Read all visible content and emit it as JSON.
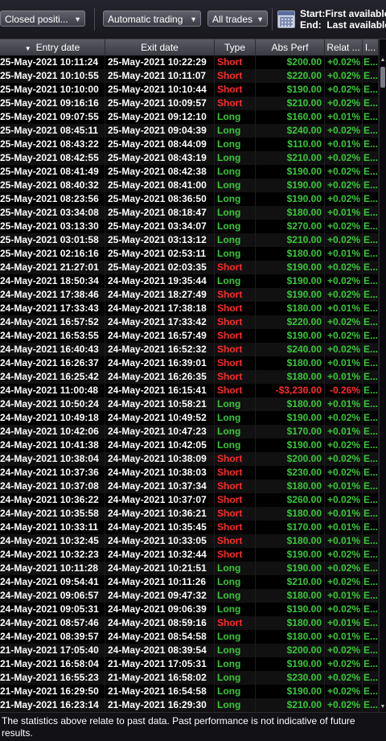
{
  "toolbar": {
    "positions_filter": "Closed positi...",
    "trading_filter": "Automatic trading",
    "trades_filter": "All trades",
    "start_label": "Start:",
    "start_value": "First available",
    "end_label": "End:",
    "end_value": "Last available"
  },
  "columns": {
    "entry": "Entry date",
    "exit": "Exit date",
    "type": "Type",
    "abs": "Abs Perf",
    "rel": "Relat ...",
    "last": "I..."
  },
  "rows": [
    {
      "entry": "25-May-2021 10:11:24",
      "exit": "25-May-2021 10:22:29",
      "type": "Short",
      "abs": "$200.00",
      "rel": "+0.02%",
      "last": "E..."
    },
    {
      "entry": "25-May-2021 10:10:55",
      "exit": "25-May-2021 10:11:07",
      "type": "Short",
      "abs": "$220.00",
      "rel": "+0.02%",
      "last": "E..."
    },
    {
      "entry": "25-May-2021 10:10:00",
      "exit": "25-May-2021 10:10:44",
      "type": "Short",
      "abs": "$190.00",
      "rel": "+0.02%",
      "last": "E..."
    },
    {
      "entry": "25-May-2021 09:16:16",
      "exit": "25-May-2021 10:09:57",
      "type": "Short",
      "abs": "$210.00",
      "rel": "+0.02%",
      "last": "E..."
    },
    {
      "entry": "25-May-2021 09:07:55",
      "exit": "25-May-2021 09:12:10",
      "type": "Long",
      "abs": "$160.00",
      "rel": "+0.01%",
      "last": "E..."
    },
    {
      "entry": "25-May-2021 08:45:11",
      "exit": "25-May-2021 09:04:39",
      "type": "Long",
      "abs": "$240.00",
      "rel": "+0.02%",
      "last": "E..."
    },
    {
      "entry": "25-May-2021 08:43:22",
      "exit": "25-May-2021 08:44:09",
      "type": "Long",
      "abs": "$110.00",
      "rel": "+0.01%",
      "last": "E..."
    },
    {
      "entry": "25-May-2021 08:42:55",
      "exit": "25-May-2021 08:43:19",
      "type": "Long",
      "abs": "$210.00",
      "rel": "+0.02%",
      "last": "E..."
    },
    {
      "entry": "25-May-2021 08:41:49",
      "exit": "25-May-2021 08:42:38",
      "type": "Long",
      "abs": "$190.00",
      "rel": "+0.02%",
      "last": "E..."
    },
    {
      "entry": "25-May-2021 08:40:32",
      "exit": "25-May-2021 08:41:00",
      "type": "Long",
      "abs": "$190.00",
      "rel": "+0.02%",
      "last": "E..."
    },
    {
      "entry": "25-May-2021 08:23:56",
      "exit": "25-May-2021 08:36:50",
      "type": "Long",
      "abs": "$190.00",
      "rel": "+0.02%",
      "last": "E..."
    },
    {
      "entry": "25-May-2021 03:34:08",
      "exit": "25-May-2021 08:18:47",
      "type": "Long",
      "abs": "$180.00",
      "rel": "+0.01%",
      "last": "E..."
    },
    {
      "entry": "25-May-2021 03:13:30",
      "exit": "25-May-2021 03:34:07",
      "type": "Long",
      "abs": "$270.00",
      "rel": "+0.02%",
      "last": "E..."
    },
    {
      "entry": "25-May-2021 03:01:58",
      "exit": "25-May-2021 03:13:12",
      "type": "Long",
      "abs": "$210.00",
      "rel": "+0.02%",
      "last": "E..."
    },
    {
      "entry": "25-May-2021 02:16:16",
      "exit": "25-May-2021 02:53:11",
      "type": "Long",
      "abs": "$180.00",
      "rel": "+0.01%",
      "last": "E..."
    },
    {
      "entry": "24-May-2021 21:27:01",
      "exit": "25-May-2021 02:03:35",
      "type": "Short",
      "abs": "$190.00",
      "rel": "+0.02%",
      "last": "E..."
    },
    {
      "entry": "24-May-2021 18:50:34",
      "exit": "24-May-2021 19:35:44",
      "type": "Long",
      "abs": "$190.00",
      "rel": "+0.02%",
      "last": "E..."
    },
    {
      "entry": "24-May-2021 17:38:46",
      "exit": "24-May-2021 18:27:49",
      "type": "Short",
      "abs": "$190.00",
      "rel": "+0.02%",
      "last": "E..."
    },
    {
      "entry": "24-May-2021 17:33:43",
      "exit": "24-May-2021 17:38:18",
      "type": "Short",
      "abs": "$180.00",
      "rel": "+0.01%",
      "last": "E..."
    },
    {
      "entry": "24-May-2021 16:57:52",
      "exit": "24-May-2021 17:33:42",
      "type": "Short",
      "abs": "$220.00",
      "rel": "+0.02%",
      "last": "E..."
    },
    {
      "entry": "24-May-2021 16:53:55",
      "exit": "24-May-2021 16:57:49",
      "type": "Short",
      "abs": "$190.00",
      "rel": "+0.02%",
      "last": "E..."
    },
    {
      "entry": "24-May-2021 16:40:43",
      "exit": "24-May-2021 16:52:32",
      "type": "Short",
      "abs": "$240.00",
      "rel": "+0.02%",
      "last": "E..."
    },
    {
      "entry": "24-May-2021 16:26:37",
      "exit": "24-May-2021 16:39:01",
      "type": "Short",
      "abs": "$180.00",
      "rel": "+0.01%",
      "last": "E..."
    },
    {
      "entry": "24-May-2021 16:25:42",
      "exit": "24-May-2021 16:26:35",
      "type": "Short",
      "abs": "$180.00",
      "rel": "+0.01%",
      "last": "E..."
    },
    {
      "entry": "24-May-2021 11:00:48",
      "exit": "24-May-2021 16:15:41",
      "type": "Short",
      "abs": "-$3,230.00",
      "rel": "-0.26%",
      "last": "E..."
    },
    {
      "entry": "24-May-2021 10:50:24",
      "exit": "24-May-2021 10:58:21",
      "type": "Long",
      "abs": "$180.00",
      "rel": "+0.01%",
      "last": "E..."
    },
    {
      "entry": "24-May-2021 10:49:18",
      "exit": "24-May-2021 10:49:52",
      "type": "Long",
      "abs": "$190.00",
      "rel": "+0.02%",
      "last": "E..."
    },
    {
      "entry": "24-May-2021 10:42:06",
      "exit": "24-May-2021 10:47:23",
      "type": "Long",
      "abs": "$170.00",
      "rel": "+0.01%",
      "last": "E..."
    },
    {
      "entry": "24-May-2021 10:41:38",
      "exit": "24-May-2021 10:42:05",
      "type": "Long",
      "abs": "$190.00",
      "rel": "+0.02%",
      "last": "E..."
    },
    {
      "entry": "24-May-2021 10:38:04",
      "exit": "24-May-2021 10:38:09",
      "type": "Short",
      "abs": "$200.00",
      "rel": "+0.02%",
      "last": "E..."
    },
    {
      "entry": "24-May-2021 10:37:36",
      "exit": "24-May-2021 10:38:03",
      "type": "Short",
      "abs": "$230.00",
      "rel": "+0.02%",
      "last": "E..."
    },
    {
      "entry": "24-May-2021 10:37:08",
      "exit": "24-May-2021 10:37:34",
      "type": "Short",
      "abs": "$180.00",
      "rel": "+0.01%",
      "last": "E..."
    },
    {
      "entry": "24-May-2021 10:36:22",
      "exit": "24-May-2021 10:37:07",
      "type": "Short",
      "abs": "$260.00",
      "rel": "+0.02%",
      "last": "E..."
    },
    {
      "entry": "24-May-2021 10:35:58",
      "exit": "24-May-2021 10:36:21",
      "type": "Short",
      "abs": "$180.00",
      "rel": "+0.01%",
      "last": "E..."
    },
    {
      "entry": "24-May-2021 10:33:11",
      "exit": "24-May-2021 10:35:45",
      "type": "Short",
      "abs": "$170.00",
      "rel": "+0.01%",
      "last": "E..."
    },
    {
      "entry": "24-May-2021 10:32:45",
      "exit": "24-May-2021 10:33:05",
      "type": "Short",
      "abs": "$180.00",
      "rel": "+0.01%",
      "last": "E..."
    },
    {
      "entry": "24-May-2021 10:32:23",
      "exit": "24-May-2021 10:32:44",
      "type": "Short",
      "abs": "$190.00",
      "rel": "+0.02%",
      "last": "E..."
    },
    {
      "entry": "24-May-2021 10:11:28",
      "exit": "24-May-2021 10:21:51",
      "type": "Long",
      "abs": "$190.00",
      "rel": "+0.02%",
      "last": "E..."
    },
    {
      "entry": "24-May-2021 09:54:41",
      "exit": "24-May-2021 10:11:26",
      "type": "Long",
      "abs": "$210.00",
      "rel": "+0.02%",
      "last": "E..."
    },
    {
      "entry": "24-May-2021 09:06:57",
      "exit": "24-May-2021 09:47:32",
      "type": "Long",
      "abs": "$180.00",
      "rel": "+0.01%",
      "last": "E..."
    },
    {
      "entry": "24-May-2021 09:05:31",
      "exit": "24-May-2021 09:06:39",
      "type": "Long",
      "abs": "$190.00",
      "rel": "+0.02%",
      "last": "E..."
    },
    {
      "entry": "24-May-2021 08:57:46",
      "exit": "24-May-2021 08:59:16",
      "type": "Short",
      "abs": "$180.00",
      "rel": "+0.01%",
      "last": "E..."
    },
    {
      "entry": "24-May-2021 08:39:57",
      "exit": "24-May-2021 08:54:58",
      "type": "Long",
      "abs": "$180.00",
      "rel": "+0.01%",
      "last": "E..."
    },
    {
      "entry": "21-May-2021 17:05:40",
      "exit": "24-May-2021 08:39:54",
      "type": "Long",
      "abs": "$200.00",
      "rel": "+0.02%",
      "last": "E..."
    },
    {
      "entry": "21-May-2021 16:58:04",
      "exit": "21-May-2021 17:05:31",
      "type": "Long",
      "abs": "$190.00",
      "rel": "+0.02%",
      "last": "E..."
    },
    {
      "entry": "21-May-2021 16:55:23",
      "exit": "21-May-2021 16:58:02",
      "type": "Long",
      "abs": "$230.00",
      "rel": "+0.02%",
      "last": "E..."
    },
    {
      "entry": "21-May-2021 16:29:50",
      "exit": "21-May-2021 16:54:58",
      "type": "Long",
      "abs": "$190.00",
      "rel": "+0.02%",
      "last": "E..."
    },
    {
      "entry": "21-May-2021 16:23:14",
      "exit": "21-May-2021 16:29:30",
      "type": "Long",
      "abs": "$210.00",
      "rel": "+0.02%",
      "last": "E..."
    }
  ],
  "disclaimer": "The statistics above relate to past data. Past performance is not indicative of future results.",
  "colors": {
    "long": "#38c838",
    "short": "#ff2b2b",
    "positive": "#38c838",
    "negative": "#ff2b2b"
  }
}
